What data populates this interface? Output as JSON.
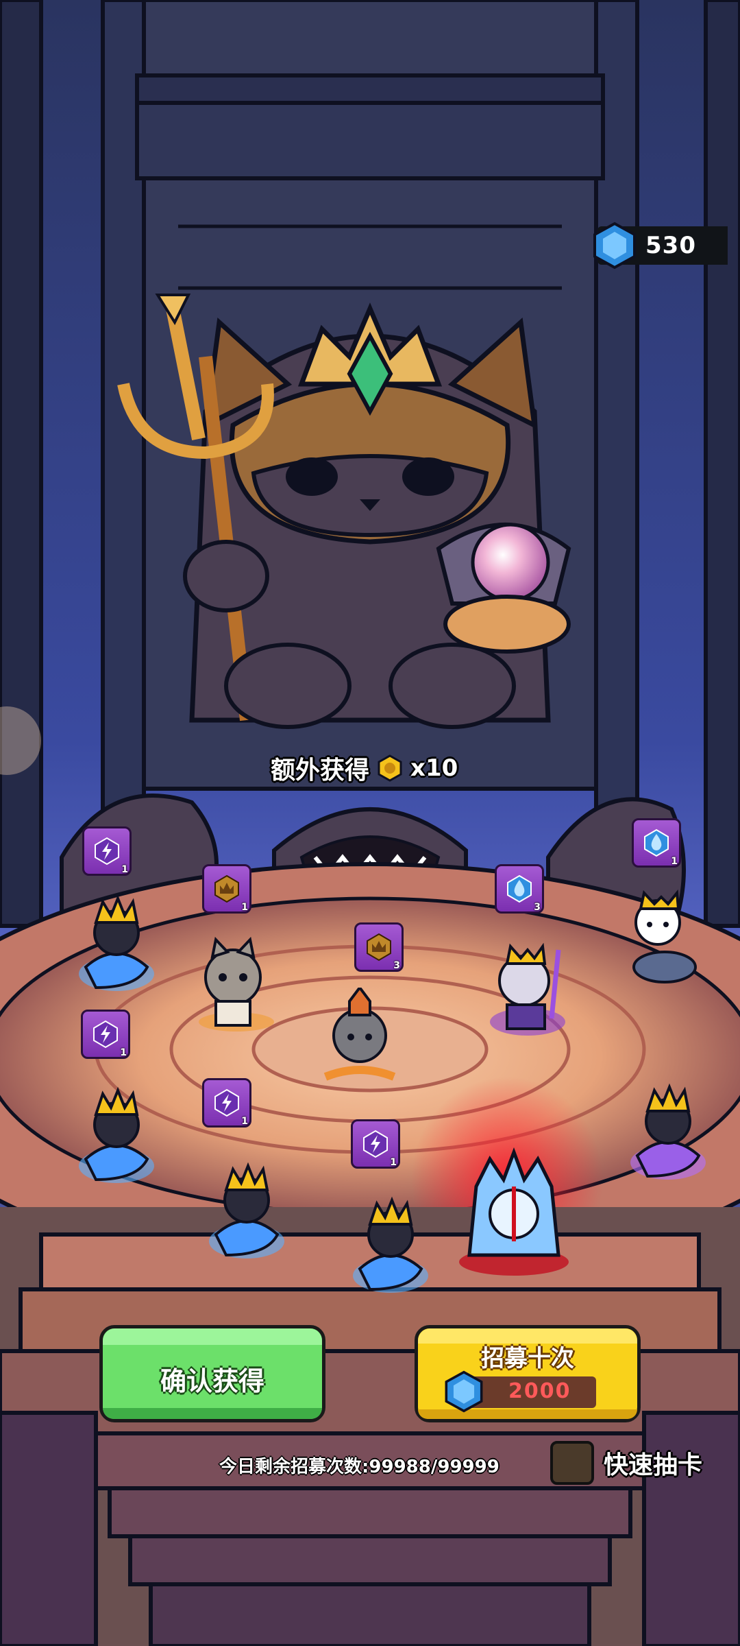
{
  "currency": {
    "gems": "530",
    "icon": "blue-gem-icon"
  },
  "bonus": {
    "label": "额外获得",
    "coin_icon": "gold-coin-icon",
    "count": "x10"
  },
  "rewards": [
    {
      "icon": "lightning-gem-icon",
      "count": "1"
    },
    {
      "icon": "crown-token-icon",
      "count": "1"
    },
    {
      "icon": "crown-token-icon",
      "count": "3"
    },
    {
      "icon": "water-drop-icon",
      "count": "3"
    },
    {
      "icon": "water-drop-icon",
      "count": "1"
    },
    {
      "icon": "lightning-gem-icon",
      "count": "1"
    },
    {
      "icon": "lightning-gem-icon",
      "count": "1"
    },
    {
      "icon": "lightning-gem-icon",
      "count": "1"
    }
  ],
  "buttons": {
    "confirm": "确认获得",
    "recruit_ten": "招募十次",
    "recruit_cost": "2000"
  },
  "remaining": "今日剩余招募次数:99988/99999",
  "quick_draw": "快速抽卡",
  "colors": {
    "confirm": "#6ce06a",
    "recruit": "#f9d21b",
    "cost_text": "#ff5a5a"
  }
}
